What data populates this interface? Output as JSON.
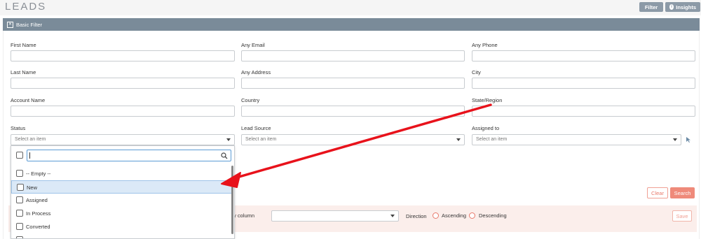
{
  "page": {
    "title": "LEADS"
  },
  "header": {
    "filter_label": "Filter",
    "insights_label": "Insights"
  },
  "filter_bar": {
    "title": "Basic Filter"
  },
  "fields": {
    "first_name": "First Name",
    "any_email": "Any Email",
    "any_phone": "Any Phone",
    "last_name": "Last Name",
    "any_address": "Any Address",
    "city": "City",
    "account_name": "Account Name",
    "country": "Country",
    "state_region": "State/Region",
    "status": "Status",
    "lead_source": "Lead Source",
    "assigned_to": "Assigned to"
  },
  "selects": {
    "status_placeholder": "Select an item",
    "lead_source_placeholder": "Select an item",
    "assigned_to_placeholder": "Select an item"
  },
  "dropdown": {
    "items": [
      "-- Empty --",
      "New",
      "Assigned",
      "In Process",
      "Converted"
    ],
    "highlighted": "New"
  },
  "actions": {
    "clear_label": "Clear",
    "search_label": "Search"
  },
  "save_bar": {
    "order_label": "der by column",
    "direction_label": "Direction",
    "ascending_label": "Ascending",
    "descending_label": "Descending",
    "save_label": "Save"
  },
  "colors": {
    "filter_bar": "#7a8b99",
    "accent": "#ef8a7a",
    "annotation_arrow": "#e8121b",
    "highlight": "#dbe9f7"
  }
}
